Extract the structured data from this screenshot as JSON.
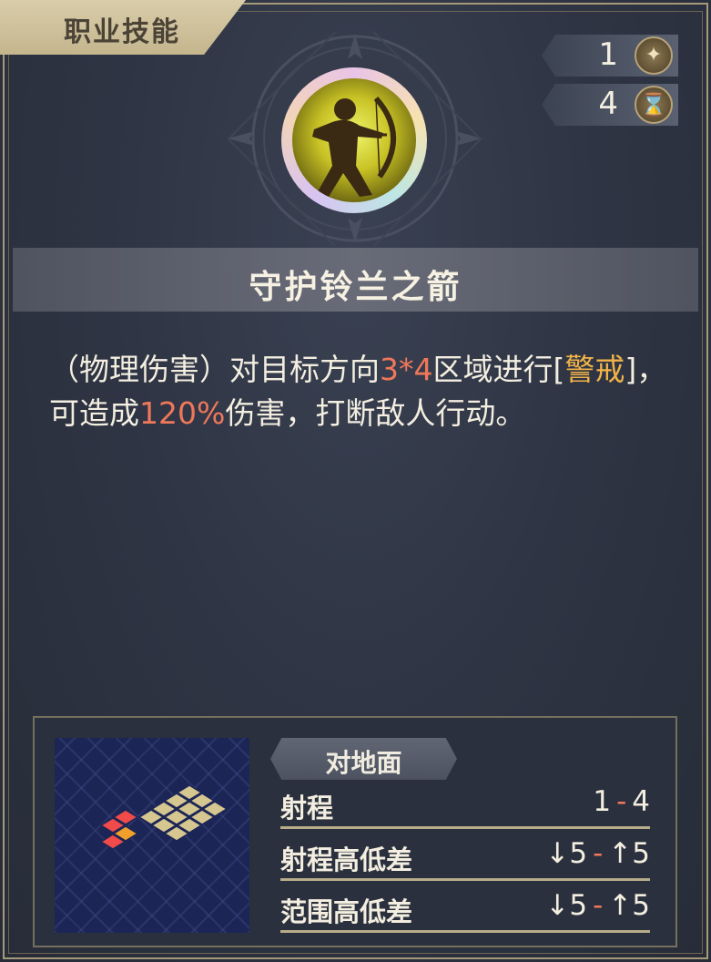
{
  "tag": {
    "label": "职业技能"
  },
  "stats": [
    {
      "value": "1",
      "icon": "star-sparkle-icon"
    },
    {
      "value": "4",
      "icon": "hourglass-icon"
    }
  ],
  "skill": {
    "icon": "archer-bow-icon",
    "name": "守护铃兰之箭",
    "desc": {
      "p1": "（物理伤害）对目标方向",
      "area": "3*4",
      "p2": "区域进行[",
      "status": "警戒",
      "p3": "]，可造成",
      "damage": "120%",
      "p4": "伤害，打断敌人行动。"
    }
  },
  "info": {
    "target": "对地面",
    "rows": [
      {
        "label": "射程",
        "min": "1",
        "max": "4"
      },
      {
        "label": "射程高低差",
        "min": "↓5",
        "max": "↑5"
      },
      {
        "label": "范围高低差",
        "min": "↓5",
        "max": "↑5"
      }
    ]
  },
  "colors": {
    "highlight_red": "#f0785a",
    "highlight_gold": "#f1b348",
    "tile_gold": "#d6c690",
    "tile_red": "#f04a4a",
    "tile_orange": "#f0a02a"
  }
}
